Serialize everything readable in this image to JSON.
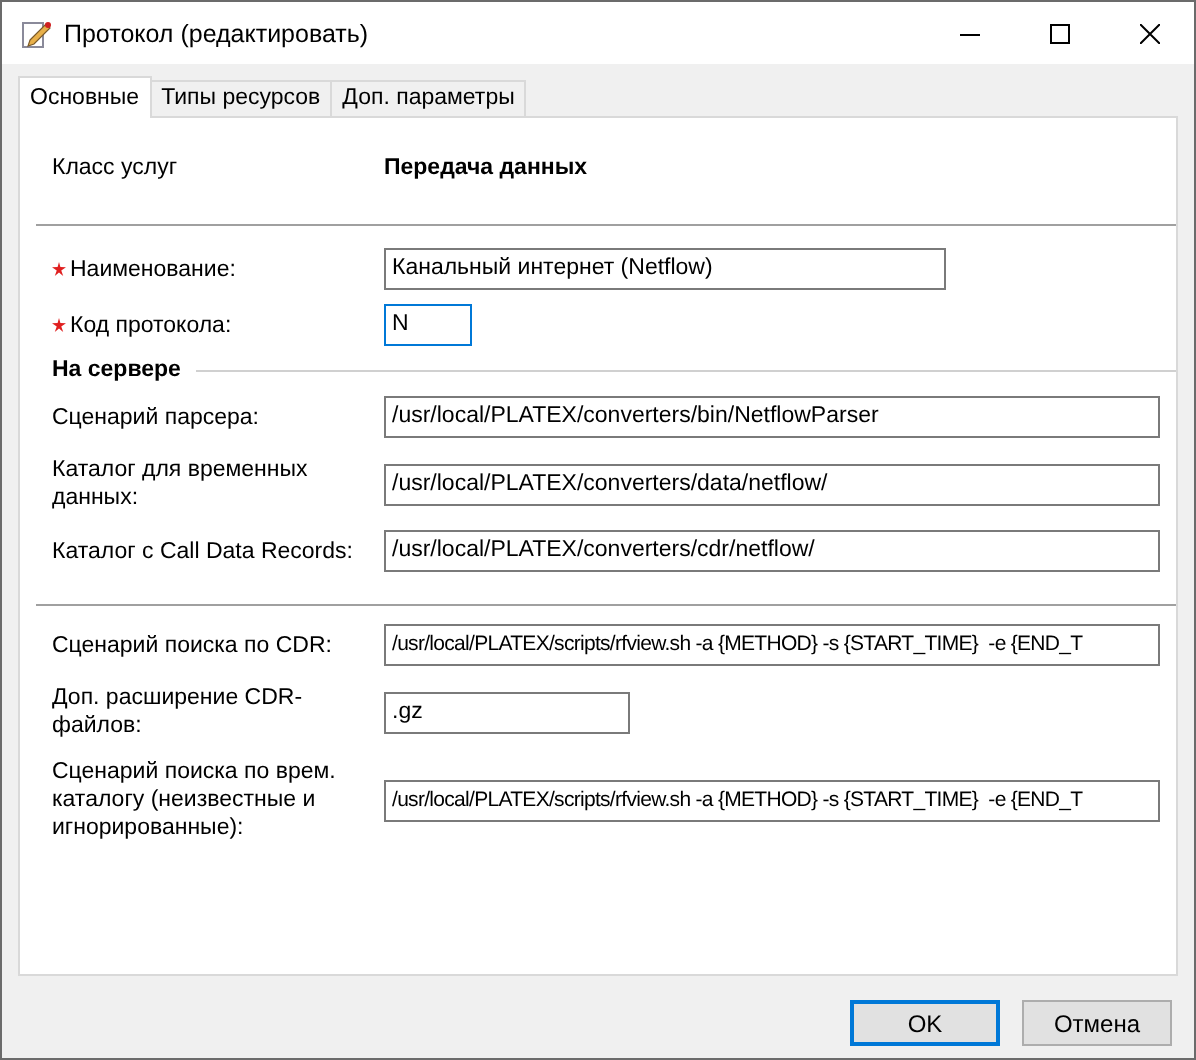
{
  "window": {
    "title": "Протокол (редактировать)"
  },
  "tabs": [
    {
      "label": "Основные",
      "selected": true
    },
    {
      "label": "Типы ресурсов",
      "selected": false
    },
    {
      "label": "Доп. параметры",
      "selected": false
    }
  ],
  "service_class": {
    "label": "Класс услуг",
    "value": "Передача данных"
  },
  "main_fields": [
    {
      "label": "Наименование:",
      "value": "Канальный интернет (Netflow)",
      "required": true,
      "focused": false
    },
    {
      "label": "Код протокола:",
      "value": "N",
      "required": true,
      "focused": true
    }
  ],
  "server_section": {
    "title": "На сервере",
    "fields": [
      {
        "label": "Сценарий парсера:",
        "value": "/usr/local/PLATEX/converters/bin/NetflowParser",
        "required": false,
        "focused": false
      },
      {
        "label": "Каталог для временных данных:",
        "value": "/usr/local/PLATEX/converters/data/netflow/",
        "required": false,
        "focused": false
      },
      {
        "label": "Каталог с Call Data Records:",
        "value": "/usr/local/PLATEX/converters/cdr/netflow/",
        "required": false,
        "focused": false
      }
    ]
  },
  "cdr_fields": [
    {
      "label": "Сценарий поиска по CDR:",
      "value": "/usr/local/PLATEX/scripts/rfview.sh -a {METHOD} -s {START_TIME}  -e {END_T",
      "required": false,
      "focused": false
    },
    {
      "label": "Доп. расширение CDR-файлов:",
      "value": ".gz",
      "required": false,
      "focused": false
    },
    {
      "label": "Сценарий поиска по врем. каталогу (неизвестные и игнорированные):",
      "value": "/usr/local/PLATEX/scripts/rfview.sh -a {METHOD} -s {START_TIME}  -e {END_T",
      "required": false,
      "focused": false
    }
  ],
  "buttons": [
    {
      "label": "OK",
      "default": true
    },
    {
      "label": "Отмена",
      "default": false
    }
  ]
}
